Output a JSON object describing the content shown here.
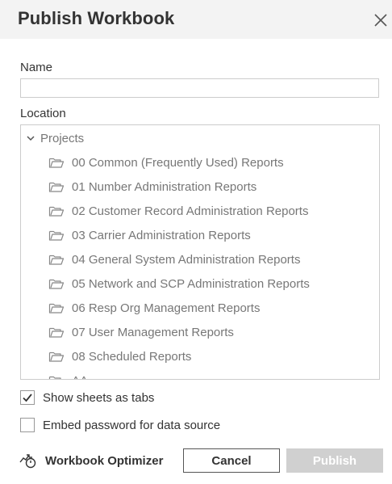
{
  "dialog": {
    "title": "Publish Workbook",
    "close_icon": "close-icon"
  },
  "name_field": {
    "label": "Name",
    "value": "",
    "placeholder": ""
  },
  "location": {
    "label": "Location",
    "root": {
      "label": "Projects",
      "expanded": true,
      "icon": "chevron-down-icon"
    },
    "items": [
      {
        "label": "00 Common (Frequently Used) Reports",
        "icon": "folder-icon"
      },
      {
        "label": "01 Number Administration Reports",
        "icon": "folder-icon"
      },
      {
        "label": "02 Customer Record Administration Reports",
        "icon": "folder-icon"
      },
      {
        "label": "03 Carrier Administration Reports",
        "icon": "folder-icon"
      },
      {
        "label": "04 General System Administration Reports",
        "icon": "folder-icon"
      },
      {
        "label": "05 Network and SCP Administration Reports",
        "icon": "folder-icon"
      },
      {
        "label": "06 Resp Org Management Reports",
        "icon": "folder-icon"
      },
      {
        "label": "07 User Management Reports",
        "icon": "folder-icon"
      },
      {
        "label": "08 Scheduled Reports",
        "icon": "folder-icon"
      },
      {
        "label": "AA",
        "icon": "folder-icon"
      }
    ]
  },
  "options": {
    "show_sheets_as_tabs": {
      "label": "Show sheets as tabs",
      "checked": true
    },
    "embed_password": {
      "label": "Embed password for data source",
      "checked": false
    }
  },
  "footer": {
    "optimizer_label": "Workbook Optimizer",
    "optimizer_icon": "optimizer-icon",
    "cancel_label": "Cancel",
    "publish_label": "Publish",
    "publish_enabled": false
  },
  "colors": {
    "header_bg": "#f3f3f3",
    "muted_text": "#777777",
    "publish_disabled_bg": "#d0d0d0"
  }
}
